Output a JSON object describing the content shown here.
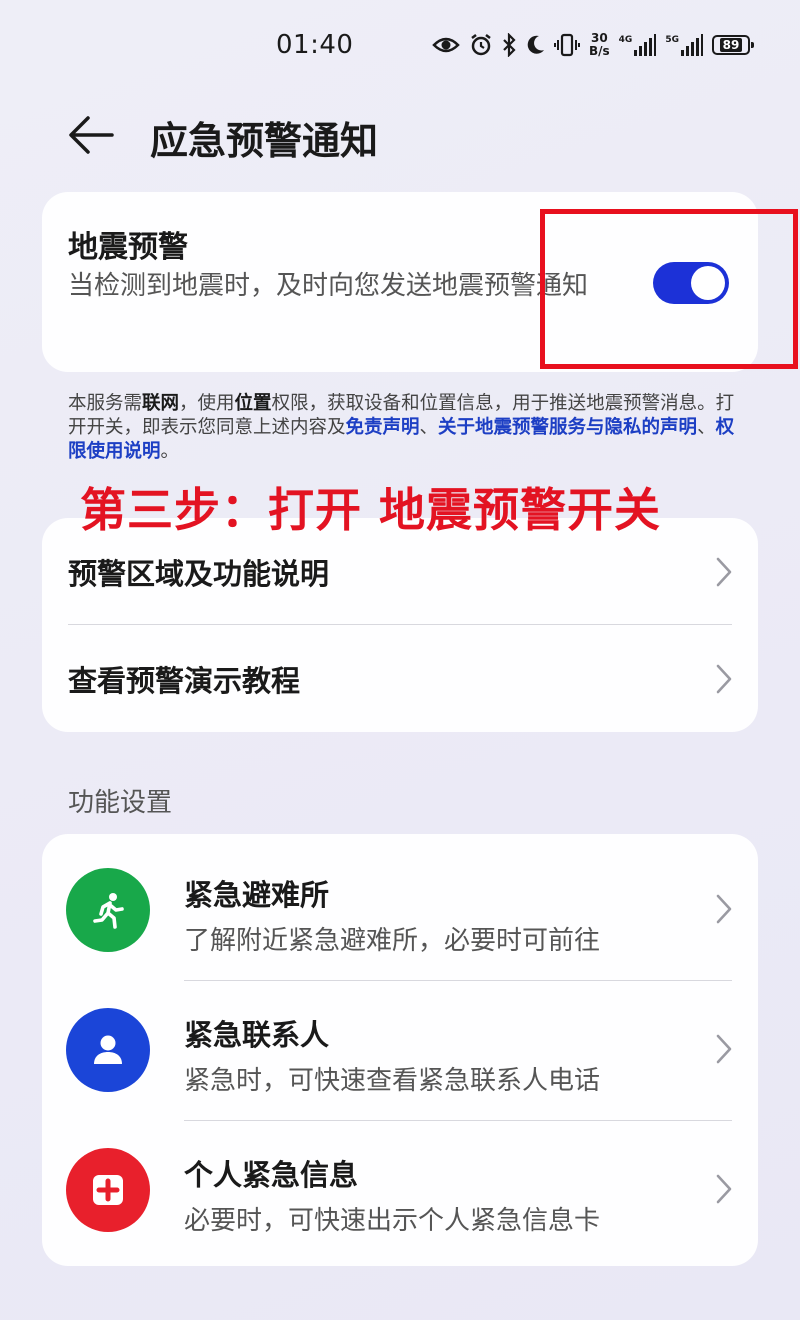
{
  "status_bar": {
    "time": "01:40",
    "net_speed_value": "30",
    "net_speed_unit": "B/s",
    "signal1_label": "4G",
    "signal2_label": "5G",
    "battery_level": "89",
    "icons": [
      "eye-icon",
      "alarm-icon",
      "bluetooth-icon",
      "moon-icon",
      "vibrate-icon",
      "signal-icon",
      "battery-icon"
    ]
  },
  "header": {
    "title": "应急预警通知",
    "back_icon": "arrow-left-icon"
  },
  "quake_card": {
    "title": "地震预警",
    "description": "当检测到地震时，及时向您发送地震预警通知",
    "toggle_on": true,
    "toggle_color": "#1c31d7"
  },
  "notice": {
    "t1": "本服务需",
    "b1": "联网",
    "t2": "，使用",
    "b2": "位置",
    "t3": "权限，获取设备和位置信息，用于推送地震预警消息。打开开关，即表示您同意上述内容及",
    "link1": "免责声明",
    "t4": "、",
    "link2": "关于地震预警服务与隐私的声明",
    "t5": "、",
    "link3": "权限使用说明",
    "t6": "。"
  },
  "annotation": {
    "text": "第三步：打开 地震预警开关",
    "color": "#e31322"
  },
  "links_card": {
    "items": [
      {
        "label": "预警区域及功能说明"
      },
      {
        "label": "查看预警演示教程"
      }
    ]
  },
  "settings": {
    "section_label": "功能设置",
    "items": [
      {
        "title": "紧急避难所",
        "description": "了解附近紧急避难所，必要时可前往",
        "icon": "running-person-icon",
        "color": "#18a84a"
      },
      {
        "title": "紧急联系人",
        "description": "紧急时，可快速查看紧急联系人电话",
        "icon": "person-icon",
        "color": "#1b45d8"
      },
      {
        "title": "个人紧急信息",
        "description": "必要时，可快速出示个人紧急信息卡",
        "icon": "medical-cross-icon",
        "color": "#e8202c"
      }
    ]
  }
}
